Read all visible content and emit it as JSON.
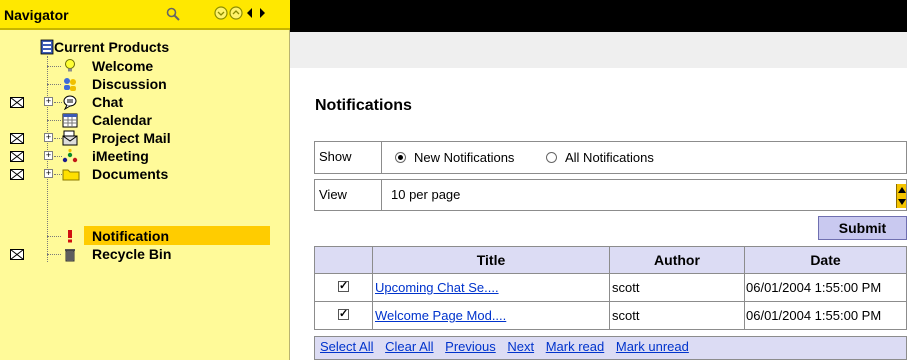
{
  "navigator": {
    "title": "Navigator",
    "tree": {
      "root": "Current Products",
      "items": [
        {
          "label": "Welcome",
          "icon": "lightbulb-icon",
          "mail": false,
          "expandable": false
        },
        {
          "label": "Discussion",
          "icon": "discussion-icon",
          "mail": false,
          "expandable": false
        },
        {
          "label": "Chat",
          "icon": "chat-icon",
          "mail": true,
          "expandable": true
        },
        {
          "label": "Calendar",
          "icon": "calendar-icon",
          "mail": false,
          "expandable": false
        },
        {
          "label": "Project Mail",
          "icon": "project-mail-icon",
          "mail": true,
          "expandable": true
        },
        {
          "label": "iMeeting",
          "icon": "meeting-icon",
          "mail": true,
          "expandable": true
        },
        {
          "label": "Documents",
          "icon": "folder-icon",
          "mail": true,
          "expandable": true
        },
        {
          "label": "Notification",
          "icon": "exclamation-icon",
          "mail": false,
          "expandable": false,
          "selected": true
        },
        {
          "label": "Recycle Bin",
          "icon": "trash-icon",
          "mail": true,
          "expandable": false
        }
      ]
    }
  },
  "content": {
    "page_title": "Notifications",
    "show": {
      "label": "Show",
      "options": [
        "New Notifications",
        "All Notifications"
      ],
      "selected": "New Notifications"
    },
    "view": {
      "label": "View",
      "selected": "10 per page"
    },
    "submit_label": "Submit",
    "table": {
      "columns": [
        "Title",
        "Author",
        "Date"
      ],
      "rows": [
        {
          "checked": true,
          "title": "Upcoming Chat Se....",
          "author": "scott",
          "date": "06/01/2004 1:55:00 PM"
        },
        {
          "checked": true,
          "title": "Welcome Page Mod....",
          "author": "scott",
          "date": "06/01/2004 1:55:00 PM"
        }
      ]
    },
    "footer_links": [
      "Select All",
      "Clear All",
      "Previous",
      "Next",
      "Mark read",
      "Mark unread"
    ]
  },
  "colors": {
    "nav_header": "#ffe800",
    "nav_background": "#fffa99",
    "selection": "#ffcc00",
    "table_header": "#dcdcf4",
    "submit_button": "#c9c9f0",
    "link": "#0033cc"
  }
}
